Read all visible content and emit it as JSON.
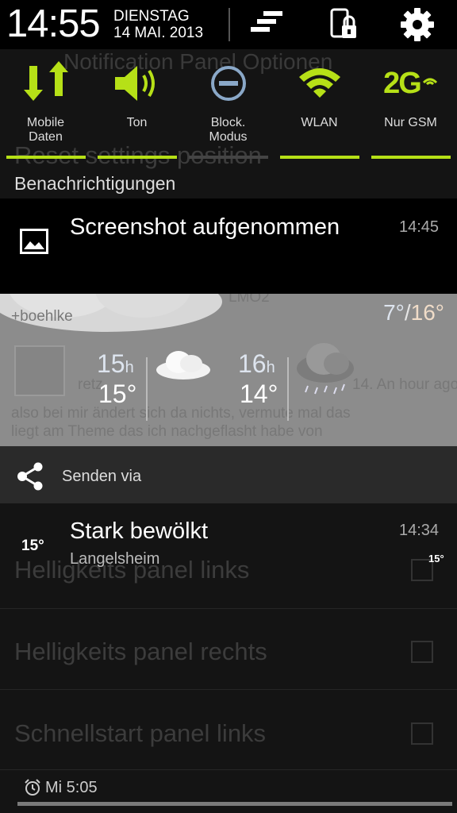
{
  "status": {
    "time": "14:55",
    "day": "DIENSTAG",
    "date": "14 MAI. 2013"
  },
  "quick_settings": [
    {
      "label": "Mobile\nDaten",
      "icon": "mobile-data-icon"
    },
    {
      "label": "Ton",
      "icon": "speaker-icon"
    },
    {
      "label": "Block.\nModus",
      "icon": "block-mode-icon"
    },
    {
      "label": "WLAN",
      "icon": "wifi-icon"
    },
    {
      "label": "Nur GSM",
      "icon": "2g-network-icon",
      "icon_text": "2G"
    }
  ],
  "notifications_header": "Benachrichtigungen",
  "screenshot_notification": {
    "title": "Screenshot aufgenommen",
    "time": "14:45"
  },
  "weather_widget": {
    "temp_range_low": "7°",
    "temp_range_sep": "/",
    "temp_range_high": "16°",
    "forecast": [
      {
        "hour": "15",
        "unit": "h",
        "temp": "15°",
        "icon": "cloud-icon"
      },
      {
        "hour": "16",
        "unit": "h",
        "temp": "14°",
        "icon": "rain-cloud-icon"
      }
    ],
    "underlying_texts": [
      "+boehlke",
      "LMO2",
      "retz",
      "14. An hour ago",
      "also bei mir ändert sich da nichts, vermute mal das",
      "liegt am Theme das ich nachgeflasht habe von"
    ]
  },
  "share": {
    "label": "Senden via"
  },
  "weather_notification": {
    "badge": "15°",
    "title": "Stark bewölkt",
    "subtitle": "Langelsheim",
    "time": "14:34",
    "small_temp": "15°"
  },
  "background_app": {
    "title": "Notification Panel Optionen",
    "rows": [
      "Reset settings position",
      "Helligkeits panel links",
      "Helligkeits panel rechts",
      "Schnellstart panel links"
    ]
  },
  "alarm": {
    "time": "Mi 5:05"
  },
  "colors": {
    "accent": "#b6e017",
    "background": "#000000",
    "weather_bg": "#8c8c8c"
  }
}
